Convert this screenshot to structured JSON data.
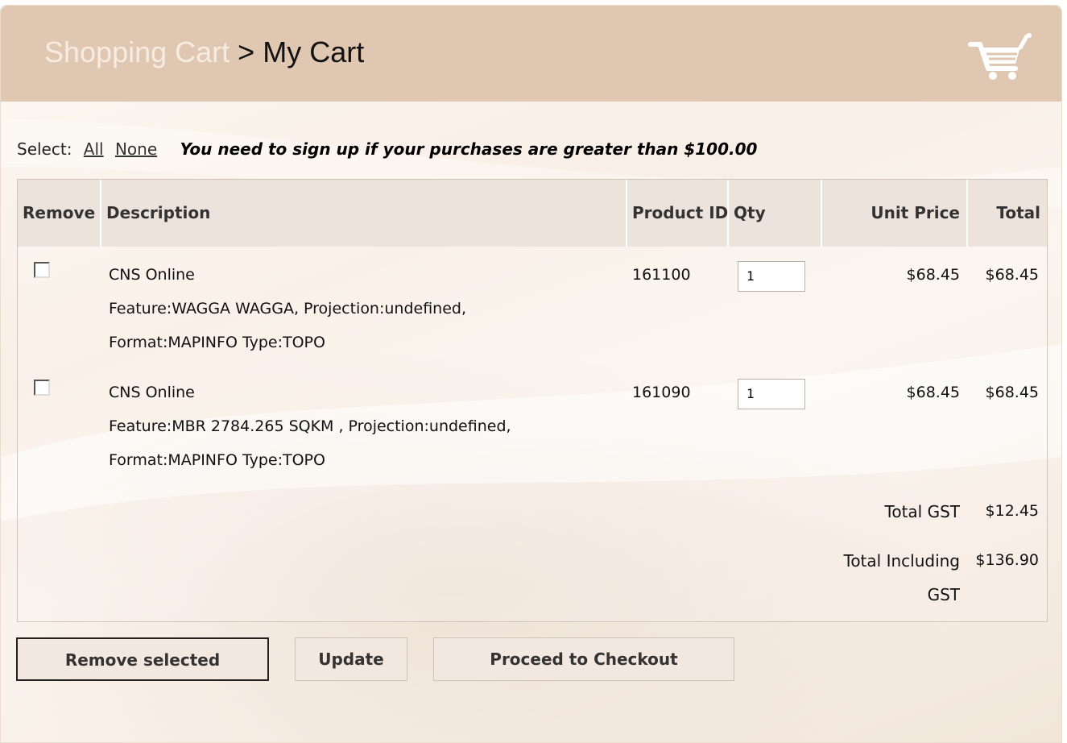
{
  "header": {
    "breadcrumb_root": "Shopping Cart",
    "breadcrumb_separator": ">",
    "breadcrumb_current": "My Cart",
    "icon": "shopping-cart-icon"
  },
  "select": {
    "label": "Select:",
    "all": "All",
    "none": "None",
    "notice": "You need to sign up if your purchases are greater than $100.00"
  },
  "table": {
    "columns": [
      "Remove",
      "Description",
      "Product ID",
      "Qty",
      "Unit Price",
      "Total"
    ],
    "rows": [
      {
        "name": "CNS Online",
        "feature": "Feature:WAGGA WAGGA, Projection:undefined,",
        "format": "Format:MAPINFO Type:TOPO",
        "product_id": "161100",
        "qty": "1",
        "unit_price": "$68.45",
        "total": "$68.45",
        "checked": false
      },
      {
        "name": "CNS Online",
        "feature": "Feature:MBR 2784.265 SQKM , Projection:undefined,",
        "format": "Format:MAPINFO Type:TOPO",
        "product_id": "161090",
        "qty": "1",
        "unit_price": "$68.45",
        "total": "$68.45",
        "checked": false
      }
    ],
    "totals": {
      "gst_label": "Total GST",
      "gst_value": "$12.45",
      "incl_label_line1": "Total Including",
      "incl_label_line2": "GST",
      "incl_value": "$136.90"
    }
  },
  "buttons": {
    "remove": "Remove selected",
    "update": "Update",
    "checkout": "Proceed to Checkout"
  },
  "colors": {
    "header_bg": "#dfc7b1",
    "table_header_bg": "#ebe3dc",
    "button_bg": "#f3e8e0"
  }
}
